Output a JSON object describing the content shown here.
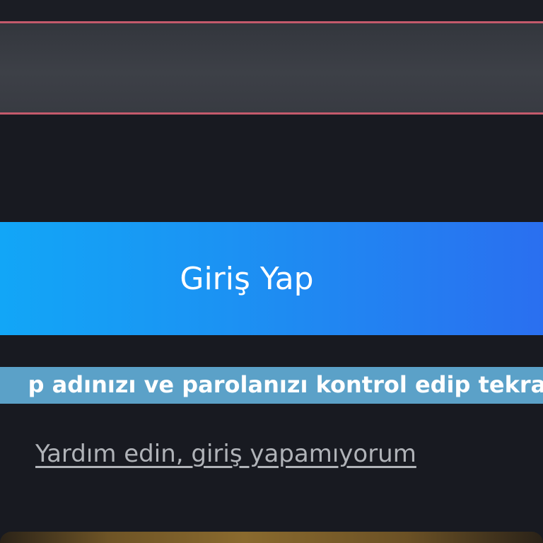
{
  "password_field": {
    "value": "",
    "placeholder": ""
  },
  "login_button": {
    "label": "Giriş Yap"
  },
  "error_message": {
    "text": "p adınızı ve parolanızı kontrol edip tekrar"
  },
  "help_link": {
    "label": "Yardım edin, giriş yapamıyorum"
  },
  "colors": {
    "background": "#181a21",
    "field_border": "#c45a6c",
    "button_gradient_start": "#12a6f7",
    "button_gradient_end": "#2a6ff0",
    "error_highlight": "#5ba1c8",
    "link": "#b0b3b8"
  }
}
